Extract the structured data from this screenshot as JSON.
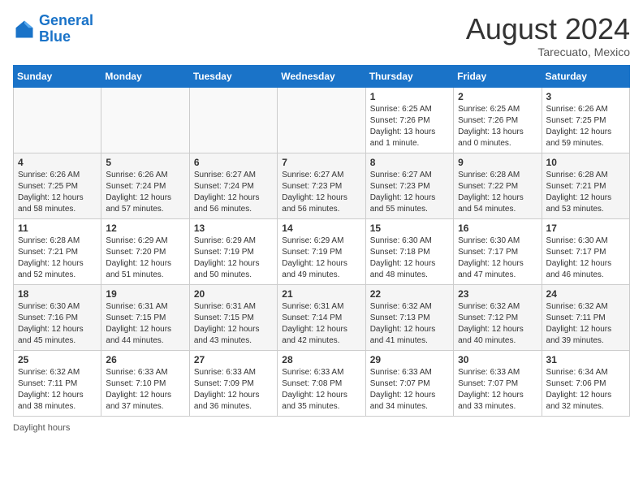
{
  "header": {
    "logo_line1": "General",
    "logo_line2": "Blue",
    "month_year": "August 2024",
    "location": "Tarecuato, Mexico"
  },
  "calendar": {
    "days_of_week": [
      "Sunday",
      "Monday",
      "Tuesday",
      "Wednesday",
      "Thursday",
      "Friday",
      "Saturday"
    ],
    "weeks": [
      [
        {
          "day": "",
          "info": ""
        },
        {
          "day": "",
          "info": ""
        },
        {
          "day": "",
          "info": ""
        },
        {
          "day": "",
          "info": ""
        },
        {
          "day": "1",
          "info": "Sunrise: 6:25 AM\nSunset: 7:26 PM\nDaylight: 13 hours\nand 1 minute."
        },
        {
          "day": "2",
          "info": "Sunrise: 6:25 AM\nSunset: 7:26 PM\nDaylight: 13 hours\nand 0 minutes."
        },
        {
          "day": "3",
          "info": "Sunrise: 6:26 AM\nSunset: 7:25 PM\nDaylight: 12 hours\nand 59 minutes."
        }
      ],
      [
        {
          "day": "4",
          "info": "Sunrise: 6:26 AM\nSunset: 7:25 PM\nDaylight: 12 hours\nand 58 minutes."
        },
        {
          "day": "5",
          "info": "Sunrise: 6:26 AM\nSunset: 7:24 PM\nDaylight: 12 hours\nand 57 minutes."
        },
        {
          "day": "6",
          "info": "Sunrise: 6:27 AM\nSunset: 7:24 PM\nDaylight: 12 hours\nand 56 minutes."
        },
        {
          "day": "7",
          "info": "Sunrise: 6:27 AM\nSunset: 7:23 PM\nDaylight: 12 hours\nand 56 minutes."
        },
        {
          "day": "8",
          "info": "Sunrise: 6:27 AM\nSunset: 7:23 PM\nDaylight: 12 hours\nand 55 minutes."
        },
        {
          "day": "9",
          "info": "Sunrise: 6:28 AM\nSunset: 7:22 PM\nDaylight: 12 hours\nand 54 minutes."
        },
        {
          "day": "10",
          "info": "Sunrise: 6:28 AM\nSunset: 7:21 PM\nDaylight: 12 hours\nand 53 minutes."
        }
      ],
      [
        {
          "day": "11",
          "info": "Sunrise: 6:28 AM\nSunset: 7:21 PM\nDaylight: 12 hours\nand 52 minutes."
        },
        {
          "day": "12",
          "info": "Sunrise: 6:29 AM\nSunset: 7:20 PM\nDaylight: 12 hours\nand 51 minutes."
        },
        {
          "day": "13",
          "info": "Sunrise: 6:29 AM\nSunset: 7:19 PM\nDaylight: 12 hours\nand 50 minutes."
        },
        {
          "day": "14",
          "info": "Sunrise: 6:29 AM\nSunset: 7:19 PM\nDaylight: 12 hours\nand 49 minutes."
        },
        {
          "day": "15",
          "info": "Sunrise: 6:30 AM\nSunset: 7:18 PM\nDaylight: 12 hours\nand 48 minutes."
        },
        {
          "day": "16",
          "info": "Sunrise: 6:30 AM\nSunset: 7:17 PM\nDaylight: 12 hours\nand 47 minutes."
        },
        {
          "day": "17",
          "info": "Sunrise: 6:30 AM\nSunset: 7:17 PM\nDaylight: 12 hours\nand 46 minutes."
        }
      ],
      [
        {
          "day": "18",
          "info": "Sunrise: 6:30 AM\nSunset: 7:16 PM\nDaylight: 12 hours\nand 45 minutes."
        },
        {
          "day": "19",
          "info": "Sunrise: 6:31 AM\nSunset: 7:15 PM\nDaylight: 12 hours\nand 44 minutes."
        },
        {
          "day": "20",
          "info": "Sunrise: 6:31 AM\nSunset: 7:15 PM\nDaylight: 12 hours\nand 43 minutes."
        },
        {
          "day": "21",
          "info": "Sunrise: 6:31 AM\nSunset: 7:14 PM\nDaylight: 12 hours\nand 42 minutes."
        },
        {
          "day": "22",
          "info": "Sunrise: 6:32 AM\nSunset: 7:13 PM\nDaylight: 12 hours\nand 41 minutes."
        },
        {
          "day": "23",
          "info": "Sunrise: 6:32 AM\nSunset: 7:12 PM\nDaylight: 12 hours\nand 40 minutes."
        },
        {
          "day": "24",
          "info": "Sunrise: 6:32 AM\nSunset: 7:11 PM\nDaylight: 12 hours\nand 39 minutes."
        }
      ],
      [
        {
          "day": "25",
          "info": "Sunrise: 6:32 AM\nSunset: 7:11 PM\nDaylight: 12 hours\nand 38 minutes."
        },
        {
          "day": "26",
          "info": "Sunrise: 6:33 AM\nSunset: 7:10 PM\nDaylight: 12 hours\nand 37 minutes."
        },
        {
          "day": "27",
          "info": "Sunrise: 6:33 AM\nSunset: 7:09 PM\nDaylight: 12 hours\nand 36 minutes."
        },
        {
          "day": "28",
          "info": "Sunrise: 6:33 AM\nSunset: 7:08 PM\nDaylight: 12 hours\nand 35 minutes."
        },
        {
          "day": "29",
          "info": "Sunrise: 6:33 AM\nSunset: 7:07 PM\nDaylight: 12 hours\nand 34 minutes."
        },
        {
          "day": "30",
          "info": "Sunrise: 6:33 AM\nSunset: 7:07 PM\nDaylight: 12 hours\nand 33 minutes."
        },
        {
          "day": "31",
          "info": "Sunrise: 6:34 AM\nSunset: 7:06 PM\nDaylight: 12 hours\nand 32 minutes."
        }
      ]
    ]
  },
  "footer": {
    "daylight_label": "Daylight hours"
  }
}
